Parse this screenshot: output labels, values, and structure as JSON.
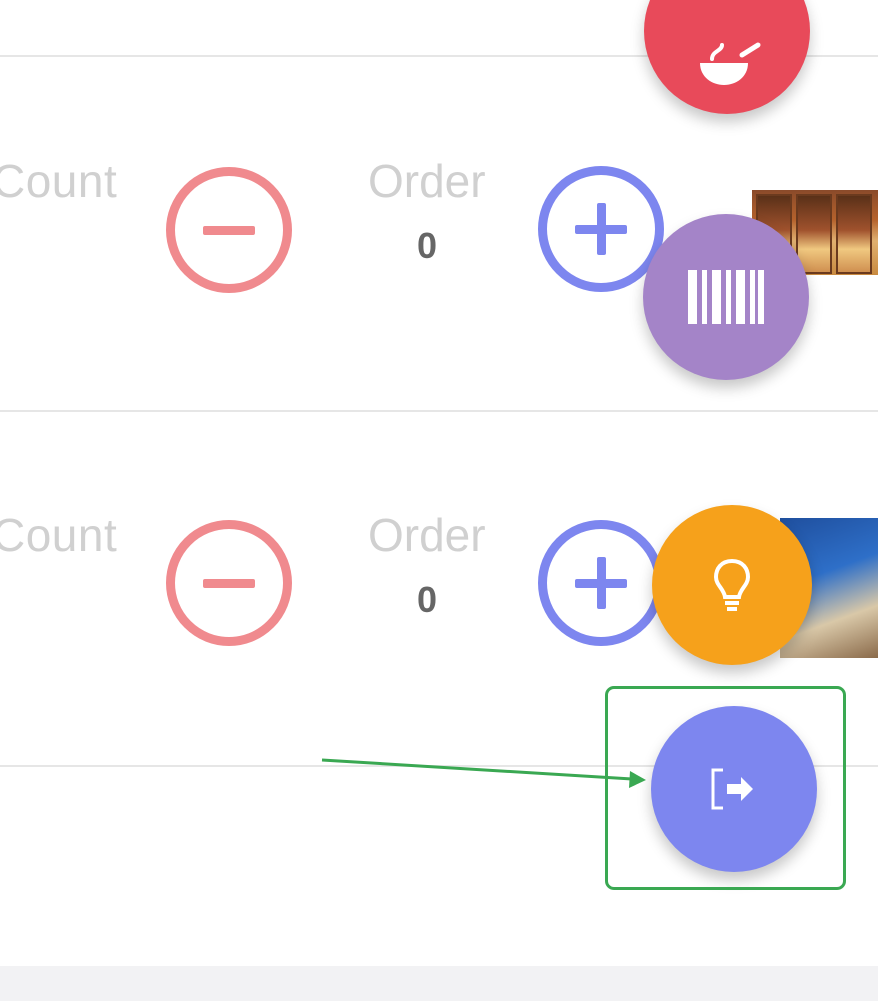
{
  "rows": [
    {
      "count_label": "Count",
      "order_label": "Order",
      "order_value": "0"
    },
    {
      "count_label": "Count",
      "order_label": "Order",
      "order_value": "0"
    }
  ],
  "fabs": {
    "top": {
      "icon": "food-bowl-icon",
      "color": "#e84a5a"
    },
    "barcode": {
      "icon": "barcode-icon",
      "color": "#a484c8"
    },
    "idea": {
      "icon": "lightbulb-icon",
      "color": "#f6a11b"
    },
    "logout": {
      "icon": "logout-icon",
      "color": "#7d86ef"
    }
  },
  "colors": {
    "minus": "#f08a8e",
    "plus": "#7d86ef",
    "highlight": "#3aa852"
  }
}
